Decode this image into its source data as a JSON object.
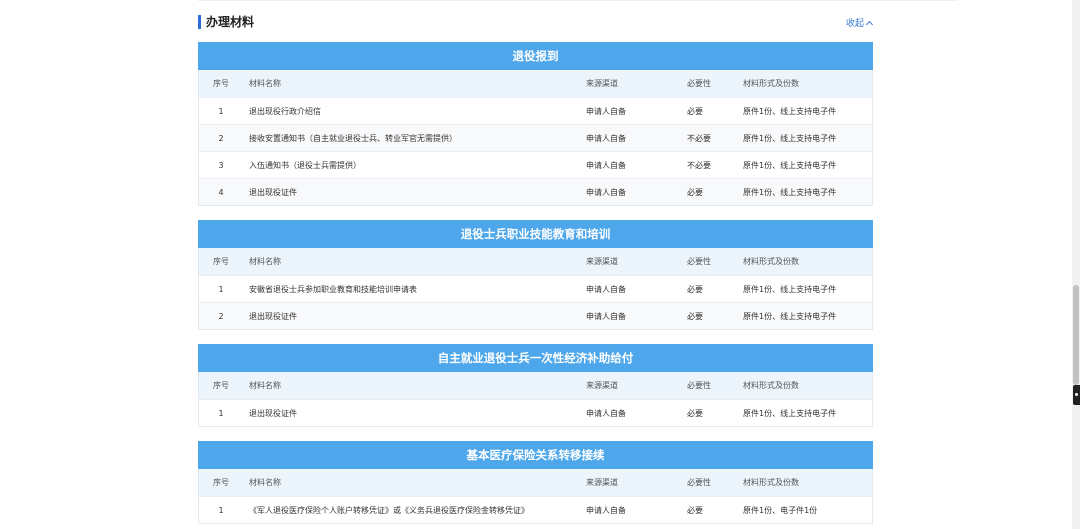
{
  "section": {
    "title": "办理材料",
    "collapse_label": "收起"
  },
  "columns": {
    "no": "序号",
    "name": "材料名称",
    "source": "来源渠道",
    "required": "必要性",
    "form": "材料形式及份数"
  },
  "groups": [
    {
      "title": "退役报到",
      "rows": [
        {
          "no": "1",
          "name": "退出现役行政介绍信",
          "source": "申请人自备",
          "required": "必要",
          "form": "原件1份、线上支持电子件"
        },
        {
          "no": "2",
          "name": "接收安置通知书（自主就业退役士兵、转业军官无需提供）",
          "source": "申请人自备",
          "required": "不必要",
          "form": "原件1份、线上支持电子件"
        },
        {
          "no": "3",
          "name": "入伍通知书（退役士兵需提供）",
          "source": "申请人自备",
          "required": "不必要",
          "form": "原件1份、线上支持电子件"
        },
        {
          "no": "4",
          "name": "退出现役证件",
          "source": "申请人自备",
          "required": "必要",
          "form": "原件1份、线上支持电子件"
        }
      ]
    },
    {
      "title": "退役士兵职业技能教育和培训",
      "rows": [
        {
          "no": "1",
          "name": "安徽省退役士兵参加职业教育和技能培训申请表",
          "source": "申请人自备",
          "required": "必要",
          "form": "原件1份、线上支持电子件"
        },
        {
          "no": "2",
          "name": "退出现役证件",
          "source": "申请人自备",
          "required": "必要",
          "form": "原件1份、线上支持电子件"
        }
      ]
    },
    {
      "title": "自主就业退役士兵一次性经济补助给付",
      "rows": [
        {
          "no": "1",
          "name": "退出现役证件",
          "source": "申请人自备",
          "required": "必要",
          "form": "原件1份、线上支持电子件"
        }
      ]
    },
    {
      "title": "基本医疗保险关系转移接续",
      "rows": [
        {
          "no": "1",
          "name": "《军人退役医疗保险个人账户转移凭证》或《义务兵退役医疗保险金转移凭证》",
          "source": "申请人自备",
          "required": "必要",
          "form": "原件1份、电子件1份"
        }
      ]
    }
  ],
  "colors": {
    "group_header_bg": "#4ea7ea",
    "accent": "#2b6fd6",
    "link": "#3a7bd5"
  }
}
